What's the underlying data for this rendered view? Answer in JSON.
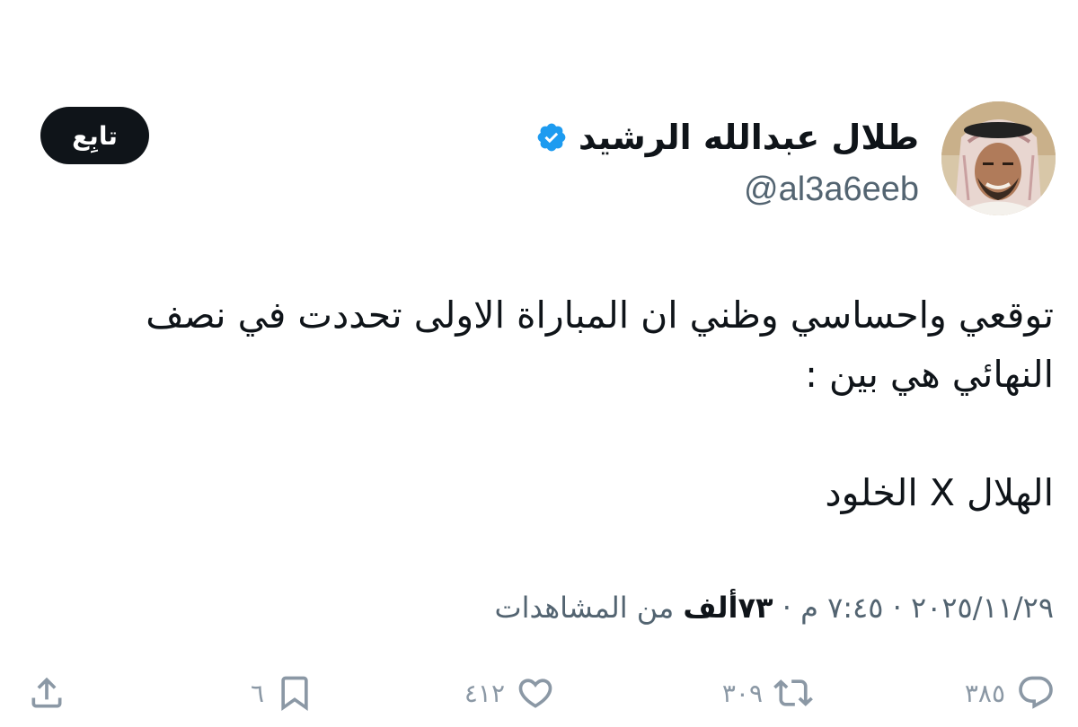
{
  "author": {
    "display_name": "طلال عبدالله الرشيد",
    "handle": "@al3a6eeb",
    "verified_icon": "verified-badge-icon",
    "verified_color": "#1d9bf0",
    "avatar_icon": "profile-photo"
  },
  "follow_button": {
    "label": "تابِع"
  },
  "tweet": {
    "lines": [
      "توقعي واحساسي وظني ان المباراة الاولى تحددت في نصف",
      "النهائي هي بين  :",
      "الهلال X الخلود"
    ]
  },
  "meta": {
    "date_time": "٢٠٢٥/١١/٢٩ · ٧:٤٥ م · ",
    "views_count": "٧٣ألف",
    "views_label": " من المشاهدات"
  },
  "actions": {
    "replies": {
      "count": "٣٨٥",
      "icon": "reply-icon"
    },
    "reposts": {
      "count": "٣٠٩",
      "icon": "repost-icon"
    },
    "likes": {
      "count": "٤١٢",
      "icon": "heart-icon"
    },
    "bookmarks": {
      "count": "٦",
      "icon": "bookmark-icon"
    },
    "share": {
      "icon": "share-icon"
    }
  },
  "colors": {
    "text_primary": "#0f1419",
    "text_secondary": "#536471",
    "action_gray": "#8b98a5",
    "follow_bg": "#0f1419",
    "follow_text": "#ffffff"
  }
}
